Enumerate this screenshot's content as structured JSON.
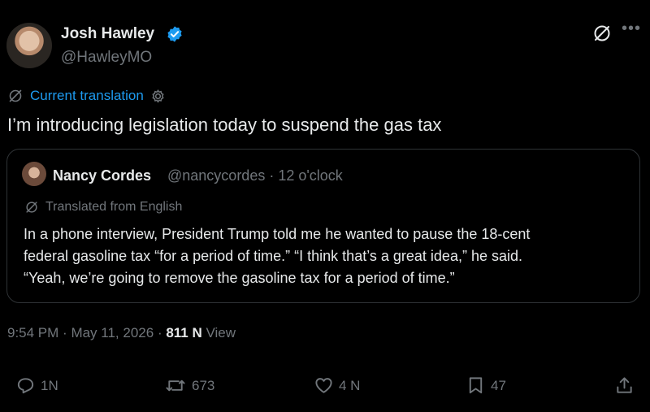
{
  "author": {
    "name": "Josh Hawley",
    "handle": "@HawleyMO"
  },
  "translation": {
    "label": "Current translation"
  },
  "tweet": {
    "text": "I’m introducing legislation today to suspend the gas tax"
  },
  "quote": {
    "name": "Nancy Cordes",
    "meta": "@nancycordes · 12 o'clock",
    "translated_label": "Translated from English",
    "lines": [
      "In a phone interview, President Trump told me he wanted to pause the 18-cent",
      "federal gasoline tax “for a period of time.” “I think that’s a great idea,” he said.",
      "“Yeah, we’re going to remove the gasoline tax for a period of time.”"
    ]
  },
  "timestamp": {
    "time": "9:54 PM",
    "date": "May 11, 2026",
    "views_count": "811 N",
    "views_label": "View"
  },
  "actions": {
    "replies": "1N",
    "reposts": "673",
    "likes": "4 N",
    "bookmarks": "47"
  },
  "colors": {
    "background": "#000000",
    "text": "#e7e9ea",
    "muted": "#71767b",
    "accent": "#1d9bf0",
    "border": "#2f3336"
  },
  "icons": [
    "verified-badge-icon",
    "translate-icon",
    "more-icon",
    "gear-icon",
    "reply-icon",
    "repost-icon",
    "like-icon",
    "bookmark-icon",
    "share-icon"
  ]
}
